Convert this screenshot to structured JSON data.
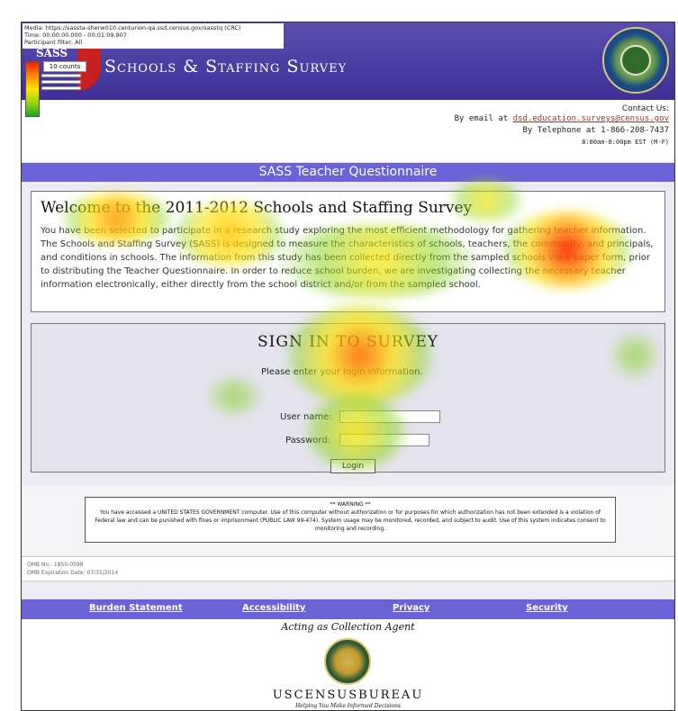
{
  "overlay": {
    "media": "Media: https://sassta-sherw010.centurion-qa.ssd.census.gov/sasstq (CRC)",
    "time": "Time: 00:00:00.000 - 00:01:09.807",
    "participant": "Participant filter: All",
    "legend_label": "10 counts",
    "logo_text": "SASS"
  },
  "header": {
    "title": "Schools & Staffing Survey",
    "seal_name": "department-of-education-seal-icon"
  },
  "contact": {
    "title": "Contact Us:",
    "email_prefix": "By email at ",
    "email": "dsd.education.surveys@census.gov",
    "phone": "By Telephone at 1-866-208-7437",
    "hours": "8:00am-8:00pm EST (M-F)"
  },
  "questionnaire_title": "SASS Teacher Questionnaire",
  "welcome": {
    "heading": "Welcome to the 2011-2012 Schools and Staffing Survey",
    "body": "You have been selected to participate in a research study exploring the most efficient methodology for gathering teacher information. The Schools and Staffing Survey (SASS) is designed to measure the characteristics of schools, teachers, the community, and principals, and conditions in schools. The information from this study has been collected directly from the sampled schools via a paper form, prior to distributing the Teacher Questionnaire. In order to reduce school burden, we are investigating collecting the necessary teacher information electronically, either directly from the school district and/or from the sampled school."
  },
  "signin": {
    "heading": "SIGN IN TO SURVEY",
    "hint": "Please enter your login information.",
    "username_label": "User name:",
    "password_label": "Password:",
    "username_value": "",
    "password_value": "",
    "button_label": "Login"
  },
  "warning": {
    "title": "** WARNING **",
    "text": "You have accessed a UNITED STATES GOVERNMENT computer. Use of this computer without authorization or for purposes for which authorization has not been extended is a violation of Federal law and can be punished with fines or imprisonment (PUBLIC LAW 99-474). System usage may be monitored, recorded, and subject to audit. Use of this system indicates consent to monitoring and recording."
  },
  "omb": {
    "number": "OMB No.: 1850-0598",
    "expiration": "OMB Expiration Date: 07/31/2014"
  },
  "footer": {
    "links": [
      "Burden Statement",
      "Accessibility",
      "Privacy",
      "Security"
    ],
    "agent": "Acting as Collection Agent",
    "census": "USCENSUSBUREAU",
    "tagline": "Helping You Make Informed Decisions"
  },
  "colors": {
    "banner": "#3f2f96",
    "nav_bar": "#6a62d6",
    "email_link": "#8a3b2a",
    "heat_hot": "#ff2a00",
    "heat_mid": "#ffe600",
    "heat_cool": "#7ccf12"
  }
}
